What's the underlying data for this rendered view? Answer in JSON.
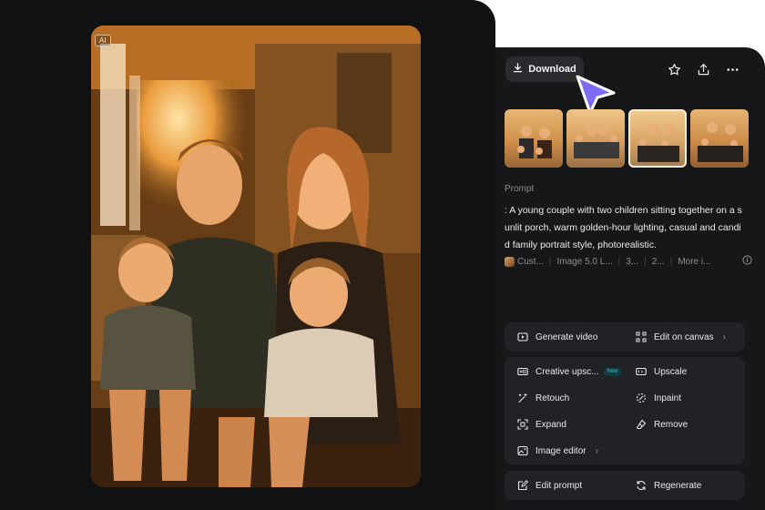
{
  "preview": {
    "badge": "AI"
  },
  "toolbar": {
    "download_label": "Download",
    "icons": [
      "download-icon",
      "star-icon",
      "share-icon",
      "more-icon"
    ]
  },
  "thumbnails": {
    "count": 4,
    "selected_index": 2
  },
  "prompt": {
    "label": "Prompt",
    "text": ": A young couple with two children sitting together on a sunlit porch, warm golden-hour lighting, casual and candid family portrait style, photorealistic."
  },
  "meta": {
    "author": "Cust...",
    "model": "Image 5.0 L...",
    "ratio": "3...",
    "resolution": "2...",
    "more": "More i...",
    "info_icon": "info-icon"
  },
  "actions": {
    "generate_video": "Generate video",
    "edit_on_canvas": "Edit on canvas",
    "creative_upscale": "Creative upsc...",
    "new_badge": "New",
    "upscale": "Upscale",
    "retouch": "Retouch",
    "inpaint": "Inpaint",
    "expand": "Expand",
    "remove": "Remove",
    "image_editor": "Image editor",
    "edit_prompt": "Edit prompt",
    "regenerate": "Regenerate"
  },
  "colors": {
    "background_dark": "#101113",
    "panel": "#161719",
    "card": "#212226",
    "cursor_accent": "#7c6cf5",
    "badge_accent": "#2ec2c9"
  }
}
